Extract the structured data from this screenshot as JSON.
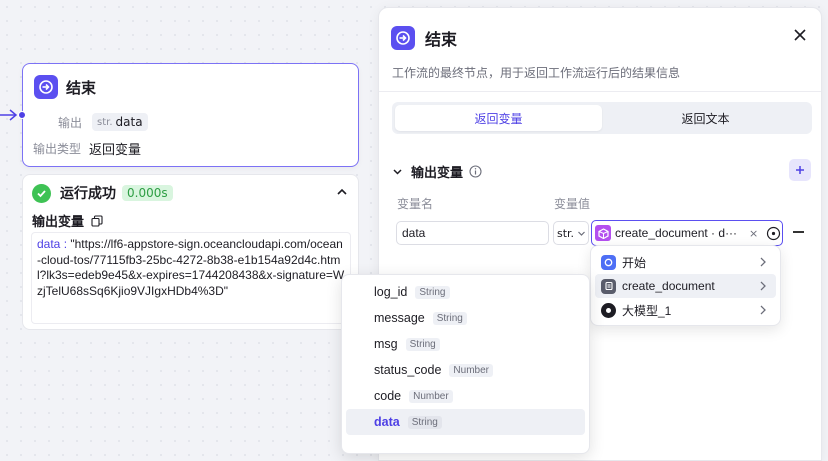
{
  "node_card": {
    "title": "结束",
    "output_label": "输出",
    "output_type_tag": "str.",
    "output_value": "data",
    "output_type_label": "输出类型",
    "output_type_value": "返回变量"
  },
  "result_card": {
    "status": "运行成功",
    "duration": "0.000s",
    "output_title": "输出变量",
    "output_key": "data",
    "output_sep": " : ",
    "output_value": "\"https://lf6-appstore-sign.oceancloudapi.com/ocean-cloud-tos/77115fb3-25bc-4272-8b38-e1b154a92d4c.html?lk3s=edeb9e45&x-expires=1744208438&x-signature=WzjTelU68sSq6Kjio9VJIgxHDb4%3D\""
  },
  "panel": {
    "title": "结束",
    "description": "工作流的最终节点，用于返回工作流运行后的结果信息",
    "tabs": [
      {
        "label": "返回变量",
        "active": true
      },
      {
        "label": "返回文本",
        "active": false
      }
    ],
    "section_title": "输出变量",
    "col_name": "变量名",
    "col_value": "变量值",
    "var_name": "data",
    "var_type": "str.",
    "var_ref": "create_document · d···",
    "ref_clear": "×"
  },
  "node_menu": [
    {
      "label": "开始",
      "icon": "start-icon",
      "hover": false
    },
    {
      "label": "create_document",
      "icon": "plugin-icon",
      "hover": true
    },
    {
      "label": "大模型_1",
      "icon": "llm-icon",
      "hover": false
    }
  ],
  "field_menu": [
    {
      "name": "log_id",
      "type": "String",
      "selected": false
    },
    {
      "name": "message",
      "type": "String",
      "selected": false
    },
    {
      "name": "msg",
      "type": "String",
      "selected": false
    },
    {
      "name": "status_code",
      "type": "Number",
      "selected": false
    },
    {
      "name": "code",
      "type": "Number",
      "selected": false
    },
    {
      "name": "data",
      "type": "String",
      "selected": true
    }
  ],
  "colors": {
    "accent": "#5b4ff0",
    "success": "#3ec254"
  }
}
